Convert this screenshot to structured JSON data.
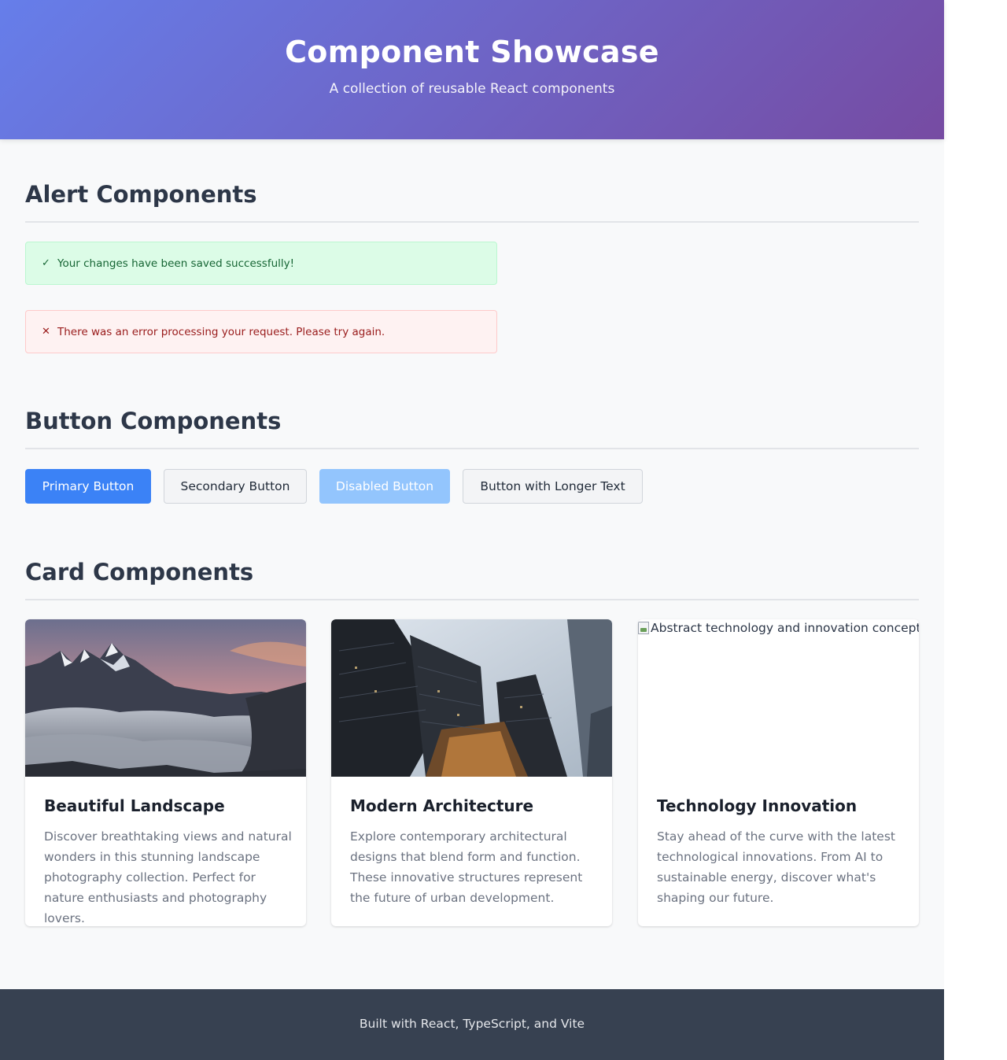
{
  "header": {
    "title": "Component Showcase",
    "subtitle": "A collection of reusable React components"
  },
  "sections": {
    "alerts": {
      "title": "Alert Components",
      "success": {
        "icon": "✓",
        "icon_name": "check-icon",
        "message": "Your changes have been saved successfully!"
      },
      "error": {
        "icon": "✕",
        "icon_name": "close-icon",
        "message": "There was an error processing your request. Please try again."
      }
    },
    "buttons": {
      "title": "Button Components",
      "items": [
        {
          "label": "Primary Button",
          "variant": "primary"
        },
        {
          "label": "Secondary Button",
          "variant": "secondary"
        },
        {
          "label": "Disabled Button",
          "variant": "disabled"
        },
        {
          "label": "Button with Longer Text",
          "variant": "secondary"
        }
      ]
    },
    "cards": {
      "title": "Card Components",
      "items": [
        {
          "image": "mountain-landscape",
          "title": "Beautiful Landscape",
          "description": "Discover breathtaking views and natural wonders in this stunning landscape photography collection. Perfect for nature enthusiasts and photography lovers."
        },
        {
          "image": "skyscrapers",
          "title": "Modern Architecture",
          "description": "Explore contemporary architectural designs that blend form and function. These innovative structures represent the future of urban development."
        },
        {
          "image_alt": "Abstract technology and innovation concept",
          "title": "Technology Innovation",
          "description": "Stay ahead of the curve with the latest technological innovations. From AI to sustainable energy, discover what's shaping our future."
        }
      ]
    }
  },
  "footer": {
    "text": "Built with React, TypeScript, and Vite"
  },
  "colors": {
    "hero_gradient_start": "#667eea",
    "hero_gradient_end": "#764ba2",
    "primary": "#3b82f6",
    "success_bg": "#dcfce7",
    "error_bg": "#fef2f2",
    "footer_bg": "#374151"
  }
}
